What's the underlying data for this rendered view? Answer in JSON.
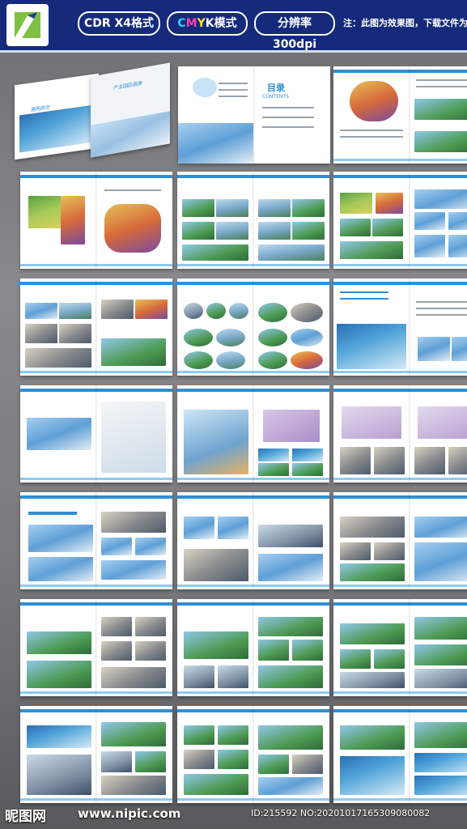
{
  "header": {
    "badge_format": "CDR X4格式",
    "badge_color_c": "C",
    "badge_color_m": "M",
    "badge_color_y": "Y",
    "badge_color_k": "K模式",
    "badge_resolution": "分辨率300dpi",
    "note": "注：此图为效果图，下载文件为源文件"
  },
  "cover": {
    "title_a": "通用航空",
    "title_b": "产业园区画册",
    "contents_title": "目录",
    "contents_sub": "CONTENTS"
  },
  "watermark": {
    "site_name": "昵图网",
    "site_url": "www.nipic.com",
    "id_line": "ID:215592 NO:20201017165309080082"
  },
  "colors": {
    "header_bg": "#152a7a",
    "accent": "#2d8fd6"
  }
}
